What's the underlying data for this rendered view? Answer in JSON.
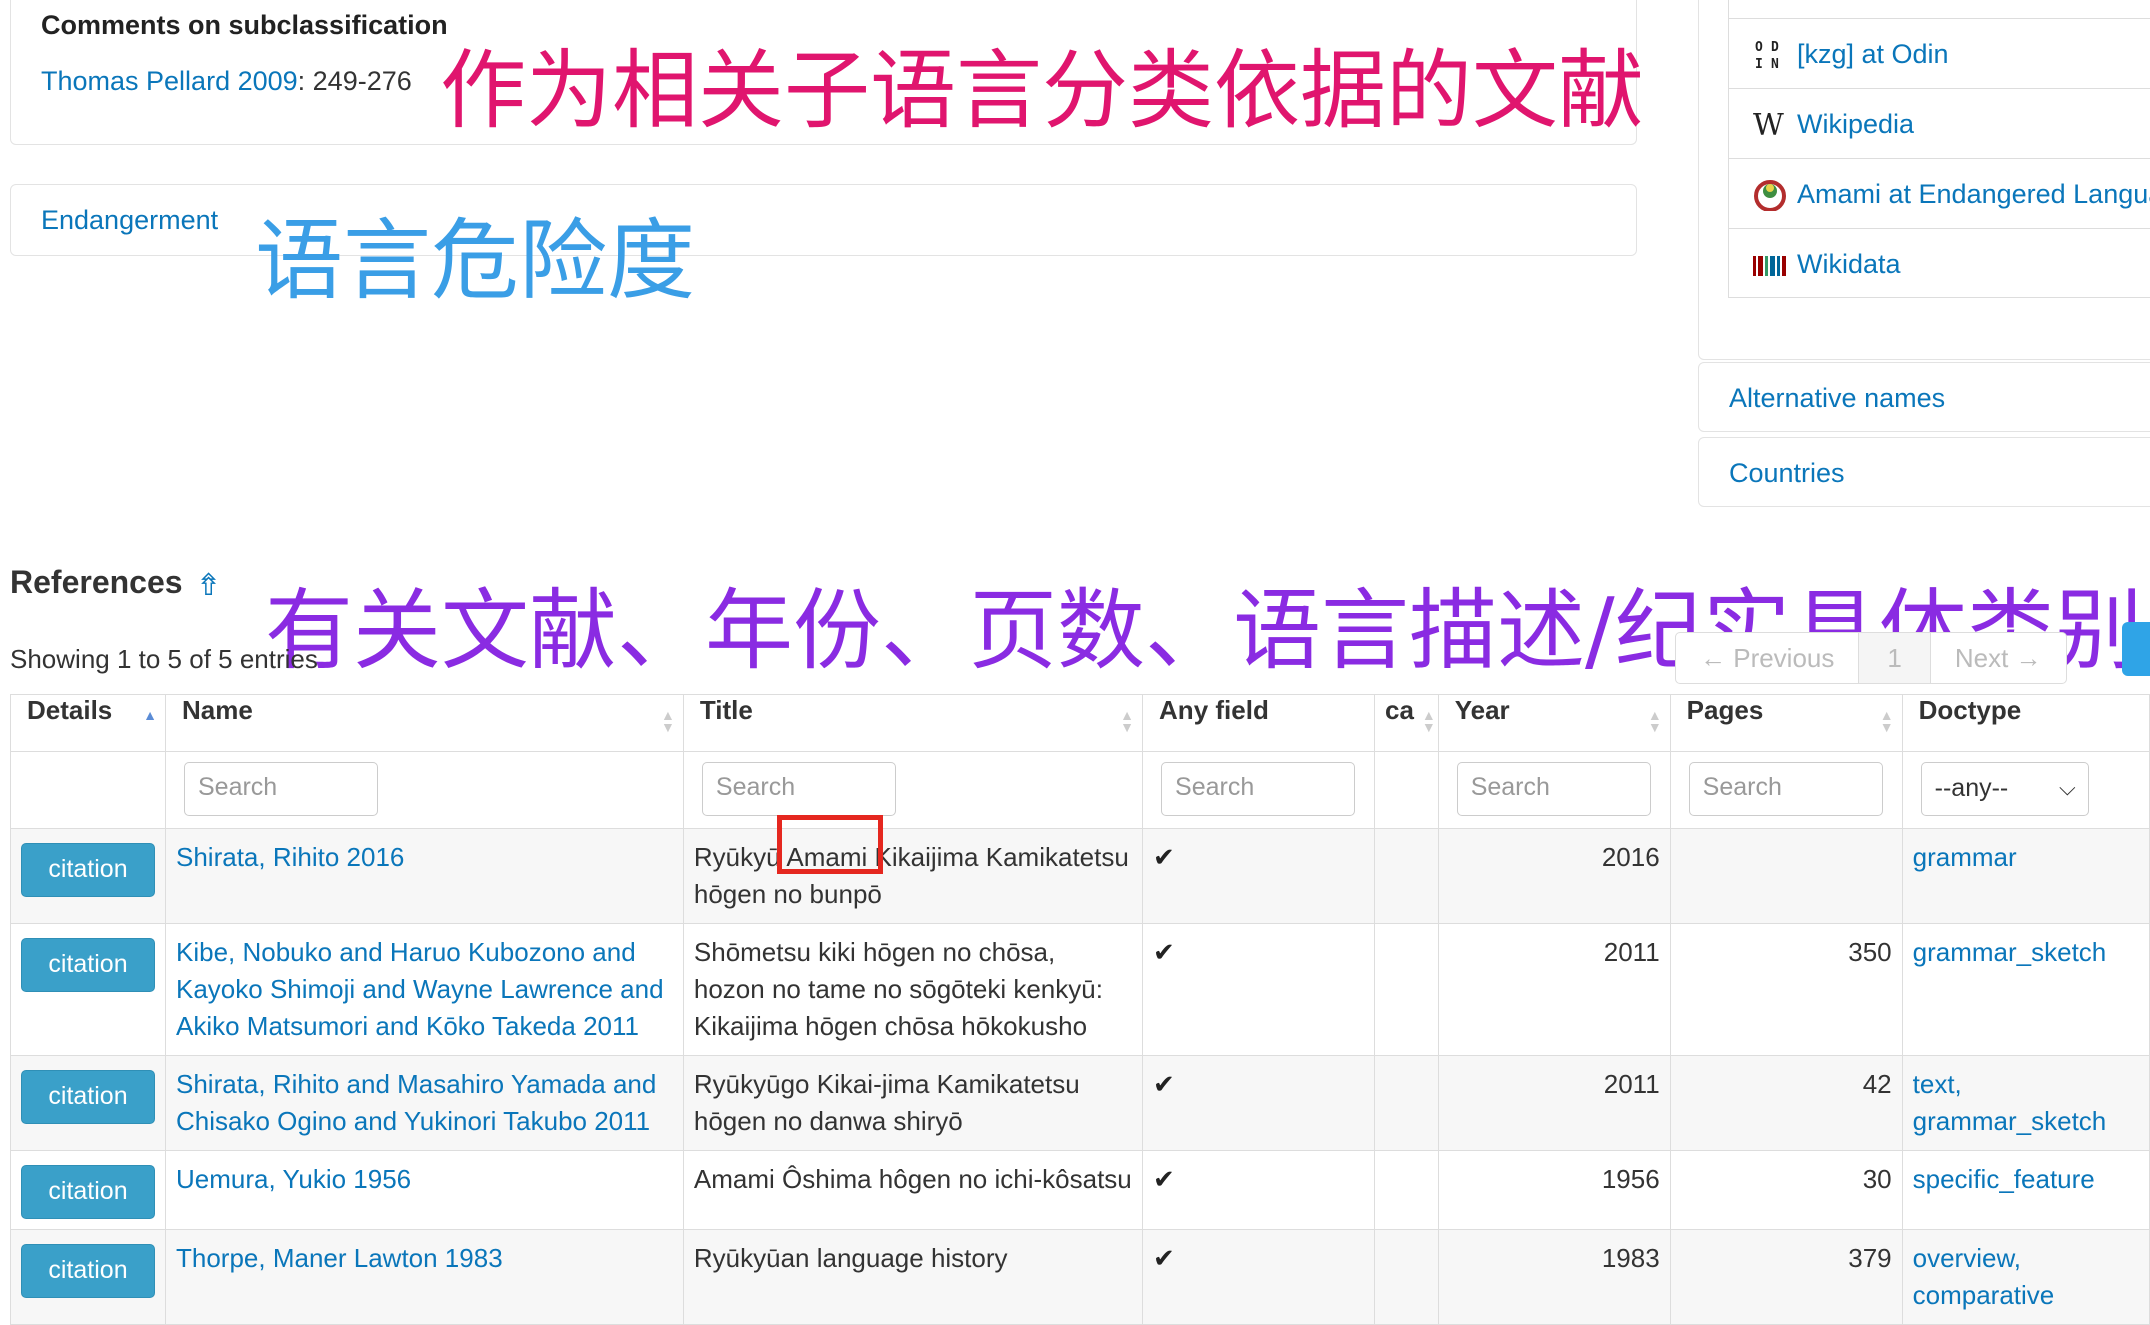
{
  "subclassification": {
    "heading": "Comments on subclassification",
    "ref_link": "Thomas Pellard 2009",
    "ref_pages": ": 249-276"
  },
  "endangerment": {
    "label": "Endangerment"
  },
  "overlays": {
    "subclassification_note": "作为相关子语言分类依据的文献",
    "endangerment_note": "语言危险度",
    "references_note": "有关文献、年份、页数、语言描述/纪实具体类别"
  },
  "sidebar": {
    "resources": [
      {
        "label": "[kzg] at Odin",
        "icon": "odin-icon"
      },
      {
        "label": "Wikipedia",
        "icon": "wikipedia-icon"
      },
      {
        "label": "Amami at Endangered Langua",
        "icon": "endangered-languages-icon"
      },
      {
        "label": "Wikidata",
        "icon": "wikidata-icon"
      }
    ],
    "alternative_names": "Alternative names",
    "countries": "Countries"
  },
  "references": {
    "heading": "References",
    "up_icon": "⇮",
    "showing": "Showing 1 to 5 of 5 entries",
    "pager": {
      "previous": "← Previous",
      "page": "1",
      "next": "Next →"
    },
    "columns": {
      "details": "Details",
      "name": "Name",
      "title": "Title",
      "any_field": "Any field",
      "ca": "ca",
      "year": "Year",
      "pages": "Pages",
      "doctype": "Doctype"
    },
    "search_placeholder": "Search",
    "doctype_filter": "--any--",
    "citation_label": "citation",
    "rows": [
      {
        "name": "Shirata, Rihito 2016",
        "title": "Ryūkyū Amami Kikaijima Kamikatetsu hōgen no bunpō",
        "year": "2016",
        "pages": "",
        "doctype": "grammar"
      },
      {
        "name": "Kibe, Nobuko and Haruo Kubozono and Kayoko Shimoji and Wayne Lawrence and Akiko Matsumori and Kōko Takeda 2011",
        "title": "Shōmetsu kiki hōgen no chōsa, hozon no tame no sōgōteki kenkyū: Kikaijima hōgen chōsa hōkokusho",
        "year": "2011",
        "pages": "350",
        "doctype": "grammar_sketch"
      },
      {
        "name": "Shirata, Rihito and Masahiro Yamada and Chisako Ogino and Yukinori Takubo 2011",
        "title": "Ryūkyūgo Kikai-jima Kamikatetsu hōgen no danwa shiryō",
        "year": "2011",
        "pages": "42",
        "doctype": "text, grammar_sketch"
      },
      {
        "name": "Uemura, Yukio 1956",
        "title": "Amami Ôshima hôgen no ichi-kôsatsu",
        "year": "1956",
        "pages": "30",
        "doctype": "specific_feature"
      },
      {
        "name": "Thorpe, Maner Lawton 1983",
        "title": "Ryūkyūan language history",
        "year": "1983",
        "pages": "379",
        "doctype": "overview, comparative"
      }
    ]
  }
}
